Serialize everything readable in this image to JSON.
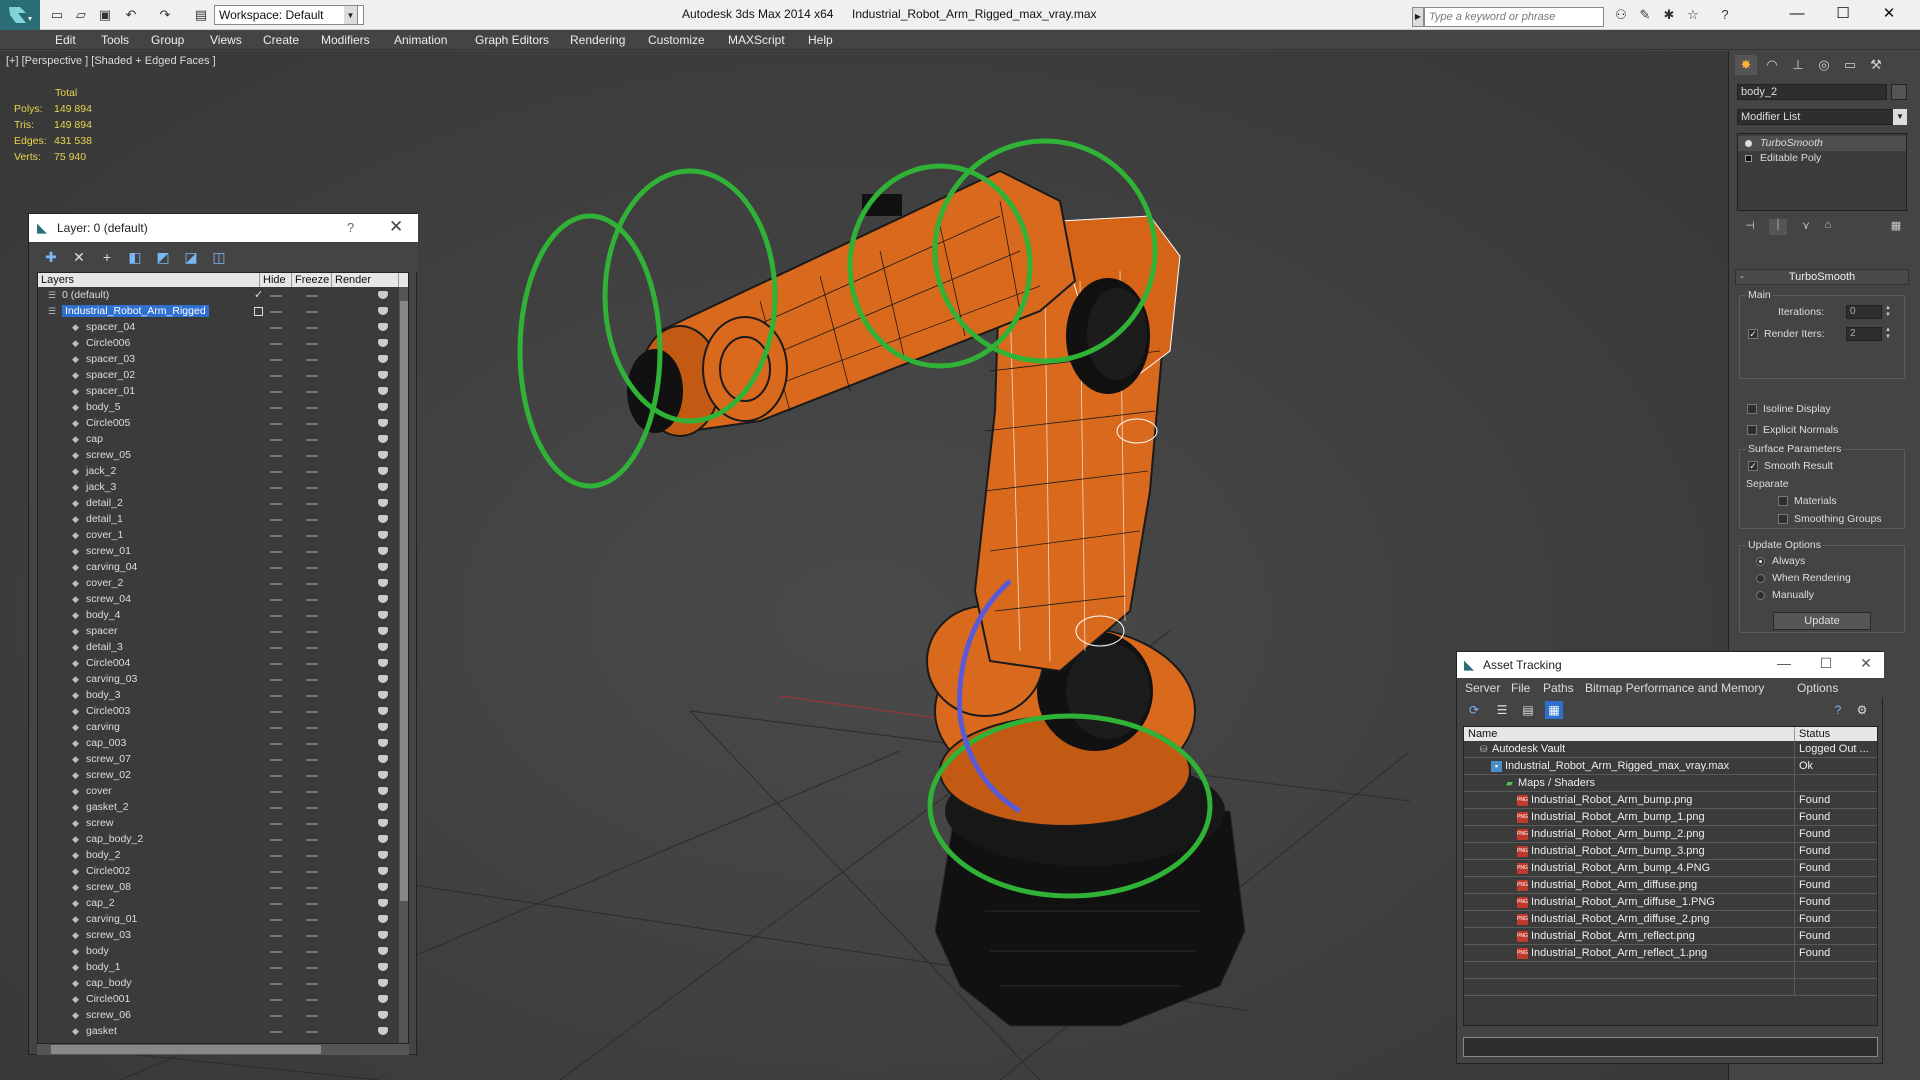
{
  "titlebar": {
    "workspace": "Workspace: Default",
    "app_title": "Autodesk 3ds Max  2014 x64",
    "file_title": "Industrial_Robot_Arm_Rigged_max_vray.max",
    "search_placeholder": "Type a keyword or phrase"
  },
  "menu": [
    "Edit",
    "Tools",
    "Group",
    "Views",
    "Create",
    "Modifiers",
    "Animation",
    "Graph Editors",
    "Rendering",
    "Customize",
    "MAXScript",
    "Help"
  ],
  "viewport": {
    "label": "[+] [Perspective ] [Shaded + Edged Faces ]",
    "stats_total": "Total",
    "stats": [
      {
        "label": "Polys:",
        "value": "149 894"
      },
      {
        "label": "Tris:",
        "value": "149 894"
      },
      {
        "label": "Edges:",
        "value": "431 538"
      },
      {
        "label": "Verts:",
        "value": "75 940"
      }
    ]
  },
  "layer_dialog": {
    "title": "Layer: 0 (default)",
    "help": "?",
    "columns": [
      "Layers",
      "Hide",
      "Freeze",
      "Render"
    ],
    "default_layer": "0 (default)",
    "selected_layer": "Industrial_Robot_Arm_Rigged",
    "objects": [
      "spacer_04",
      "Circle006",
      "spacer_03",
      "spacer_02",
      "spacer_01",
      "body_5",
      "Circle005",
      "cap",
      "screw_05",
      "jack_2",
      "jack_3",
      "detail_2",
      "detail_1",
      "cover_1",
      "screw_01",
      "carving_04",
      "cover_2",
      "screw_04",
      "body_4",
      "spacer",
      "detail_3",
      "Circle004",
      "carving_03",
      "body_3",
      "Circle003",
      "carving",
      "cap_003",
      "screw_07",
      "screw_02",
      "cover",
      "gasket_2",
      "screw",
      "cap_body_2",
      "body_2",
      "Circle002",
      "screw_08",
      "cap_2",
      "carving_01",
      "screw_03",
      "body",
      "body_1",
      "cap_body",
      "Circle001",
      "screw_06",
      "gasket"
    ]
  },
  "command_panel": {
    "object_name": "body_2",
    "modifier_list": "Modifier List",
    "stack": [
      "TurboSmooth",
      "Editable Poly"
    ],
    "rollout_title": "TurboSmooth",
    "main_group": "Main",
    "iterations_label": "Iterations:",
    "iterations_value": "0",
    "render_iters_label": "Render Iters:",
    "render_iters_value": "2",
    "isoline": "Isoline Display",
    "explicit_normals": "Explicit Normals",
    "surface_group": "Surface Parameters",
    "smooth_result": "Smooth Result",
    "separate": "Separate",
    "materials": "Materials",
    "smoothing_groups": "Smoothing Groups",
    "update_group": "Update Options",
    "always": "Always",
    "when_rendering": "When Rendering",
    "manually": "Manually",
    "update_button": "Update"
  },
  "asset_tracking": {
    "title": "Asset Tracking",
    "menu": [
      "Server",
      "File",
      "Paths",
      "Bitmap Performance and Memory",
      "Options"
    ],
    "columns": [
      "Name",
      "Status"
    ],
    "rows": [
      {
        "name": "Autodesk Vault",
        "status": "Logged Out ...",
        "indent": 0,
        "icon": "vault"
      },
      {
        "name": "Industrial_Robot_Arm_Rigged_max_vray.max",
        "status": "Ok",
        "indent": 1,
        "icon": "file"
      },
      {
        "name": "Maps / Shaders",
        "status": "",
        "indent": 2,
        "icon": "maps"
      },
      {
        "name": "Industrial_Robot_Arm_bump.png",
        "status": "Found",
        "indent": 3,
        "icon": "png"
      },
      {
        "name": "Industrial_Robot_Arm_bump_1.png",
        "status": "Found",
        "indent": 3,
        "icon": "png"
      },
      {
        "name": "Industrial_Robot_Arm_bump_2.png",
        "status": "Found",
        "indent": 3,
        "icon": "png"
      },
      {
        "name": "Industrial_Robot_Arm_bump_3.png",
        "status": "Found",
        "indent": 3,
        "icon": "png"
      },
      {
        "name": "Industrial_Robot_Arm_bump_4.PNG",
        "status": "Found",
        "indent": 3,
        "icon": "png"
      },
      {
        "name": "Industrial_Robot_Arm_diffuse.png",
        "status": "Found",
        "indent": 3,
        "icon": "png"
      },
      {
        "name": "Industrial_Robot_Arm_diffuse_1.PNG",
        "status": "Found",
        "indent": 3,
        "icon": "png"
      },
      {
        "name": "Industrial_Robot_Arm_diffuse_2.png",
        "status": "Found",
        "indent": 3,
        "icon": "png"
      },
      {
        "name": "Industrial_Robot_Arm_reflect.png",
        "status": "Found",
        "indent": 3,
        "icon": "png"
      },
      {
        "name": "Industrial_Robot_Arm_reflect_1.png",
        "status": "Found",
        "indent": 3,
        "icon": "png"
      }
    ],
    "png_icon": "PNG"
  },
  "colors": {
    "robot_orange": "#d9691c",
    "gizmo_green": "#2fb236",
    "selection_blue": "#2f6fd0",
    "stats_yellow": "#e8d44d"
  }
}
